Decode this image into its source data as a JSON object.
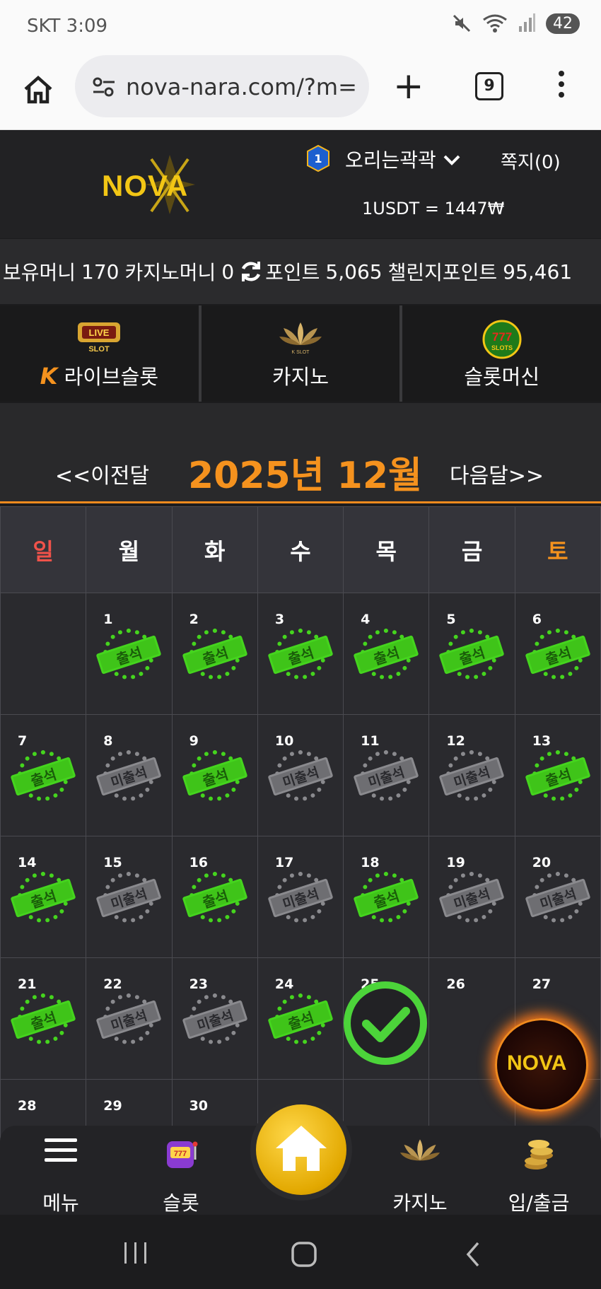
{
  "status_bar": {
    "carrier_time": "SKT 3:09",
    "battery": "42"
  },
  "browser": {
    "url": "nova-nara.com/?m=1",
    "tab_count": "9"
  },
  "header": {
    "logo_text": "NOVA",
    "level": "1",
    "username": "오리는곽곽",
    "messages": "쪽지(0)",
    "rate": "1USDT = 1447₩"
  },
  "balances": {
    "holding_label": "보유머니",
    "holding_value": "170",
    "casino_label": "카지노머니",
    "casino_value": "0",
    "point_label": "포인트",
    "point_value": "5,065",
    "challenge_label": "챌린지포인트",
    "challenge_value": "95,461"
  },
  "game_nav": [
    {
      "label": "라이브슬롯",
      "badge": "LIVE SLOT"
    },
    {
      "label": "카지노",
      "badge": "K SLOT"
    },
    {
      "label": "슬롯머신",
      "badge": "777 SLOTS"
    }
  ],
  "calendar": {
    "prev": "<<이전달",
    "next": "다음달>>",
    "month": "2025년 12월",
    "weekdays": [
      "일",
      "월",
      "화",
      "수",
      "목",
      "금",
      "토"
    ],
    "attended_label": "출석",
    "absent_label": "미출석",
    "days": [
      "1",
      "2",
      "3",
      "4",
      "5",
      "6",
      "7",
      "8",
      "9",
      "10",
      "11",
      "12",
      "13",
      "14",
      "15",
      "16",
      "17",
      "18",
      "19",
      "20",
      "21",
      "22",
      "23",
      "24",
      "25",
      "26",
      "27",
      "28",
      "29",
      "30"
    ]
  },
  "float_logo": "NOVA",
  "bottom_nav": {
    "menu": "메뉴",
    "slot": "슬롯",
    "casino": "카지노",
    "deposit": "입/출금"
  },
  "colors": {
    "accent": "#f5921e",
    "attended": "#45d41e",
    "absent": "#8a8a8e",
    "sunday": "#f0524a"
  }
}
